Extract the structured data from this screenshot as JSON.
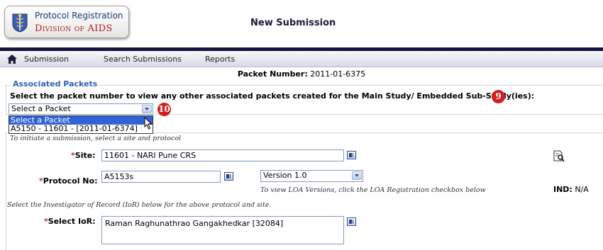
{
  "header": {
    "logo_line1": "Protocol Registration",
    "logo_line2": "Division of AIDS",
    "title": "New Submission"
  },
  "nav": {
    "items": [
      "Submission",
      "Search Submissions",
      "Reports"
    ]
  },
  "packet": {
    "label": "Packet Number:",
    "value": "2011-01-6375"
  },
  "associated": {
    "title": "Associated Packets",
    "instruction": "Select the packet number to view any other associated packets created for the Main Study/ Embedded Sub-Study(ies):",
    "select_value": "Select a Packet",
    "options": [
      "Select a Packet",
      "A5150 - 11601 - [2011-01-6374]"
    ],
    "badge_instruction": "9",
    "badge_select": "10"
  },
  "form": {
    "initiate_note": "To initiate a submission, select a site and protocol",
    "site_label": "Site:",
    "site_value": "11601 - NARI Pune CRS",
    "protocol_label": "Protocol No:",
    "protocol_value": "A5153s",
    "version_value": "Version 1.0",
    "loa_note": "To view LOA Versions, click the LOA Registration checkbox below",
    "ind_label": "IND:",
    "ind_value": "N/A",
    "ior_note": "Select the Investigator of Record (IoR) below for the above protocol and site.",
    "ior_label": "Select IoR:",
    "ior_value": "Raman Raghunathrao Gangakhedkar [32084]",
    "required_mark": "*"
  },
  "colors": {
    "nav_rule": "#15153d",
    "accent_blue": "#2d63b5",
    "badge_red": "#d11f1f",
    "selection_blue": "#3163d6"
  }
}
